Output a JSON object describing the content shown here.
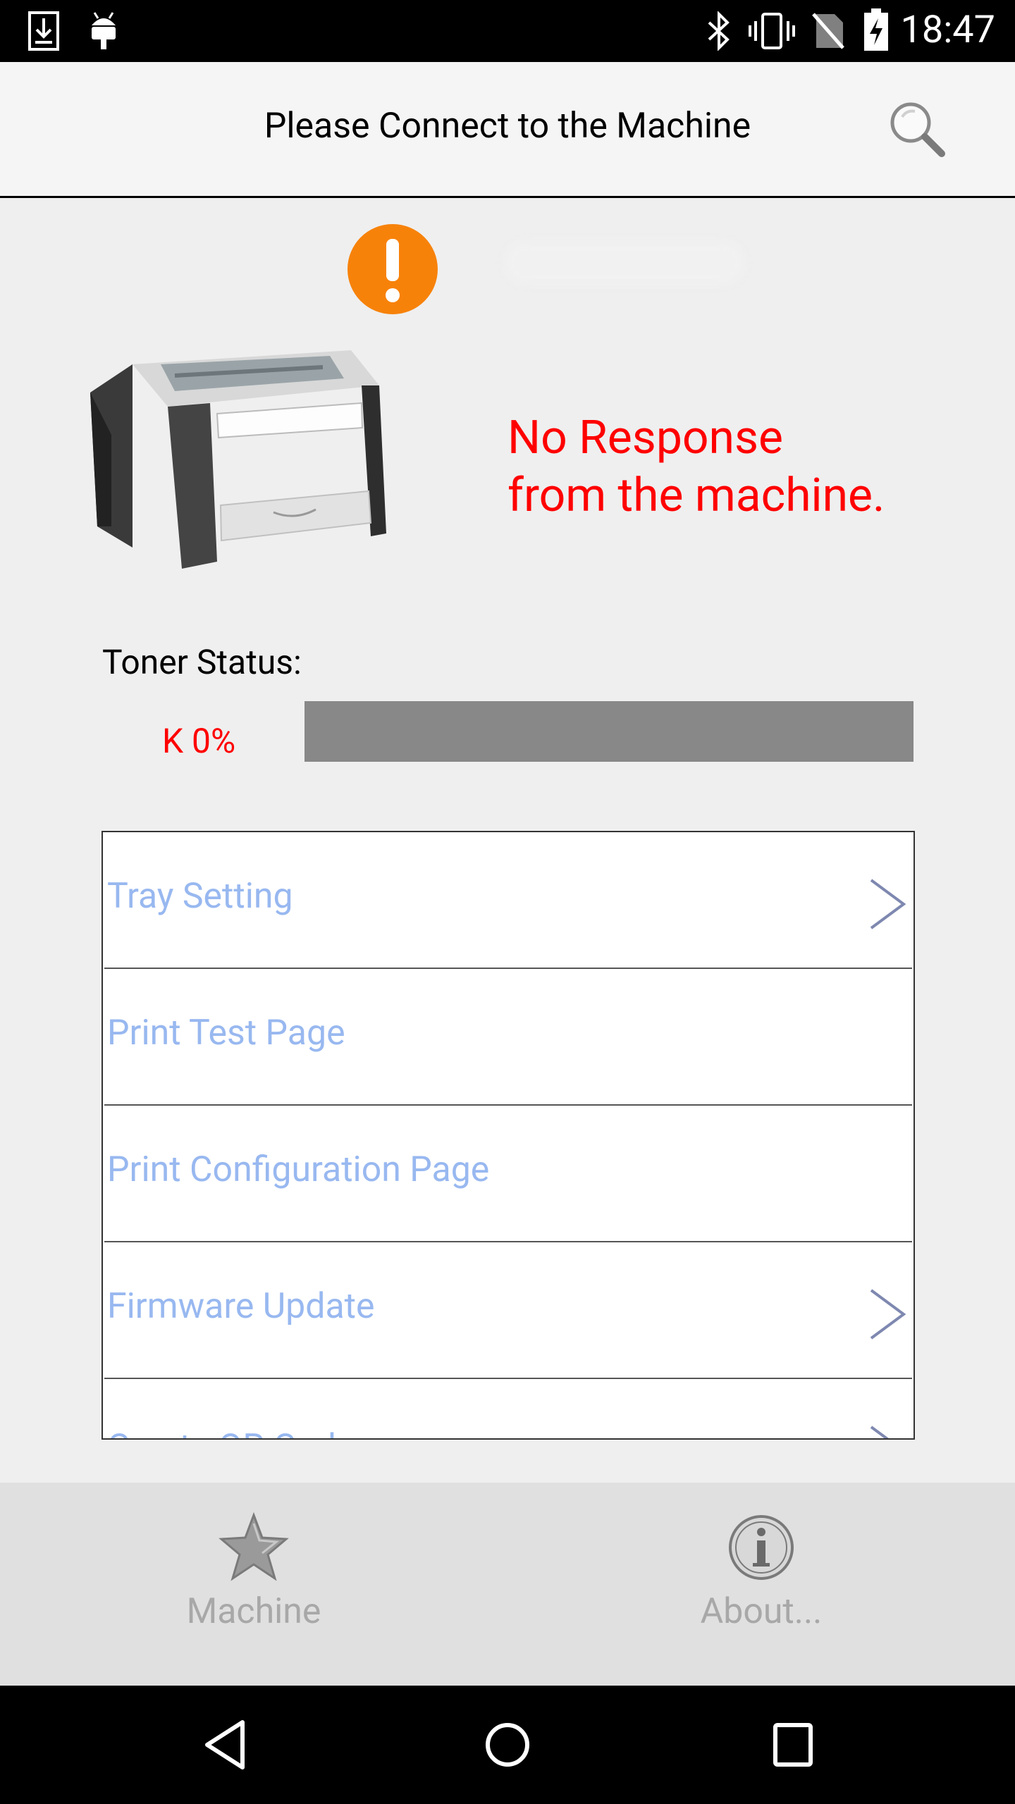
{
  "status_bar": {
    "time": "18:47",
    "icons": [
      "download-icon",
      "android-debug-icon",
      "bluetooth-icon",
      "vibrate-icon",
      "no-sim-icon",
      "battery-charging-icon"
    ]
  },
  "header": {
    "title": "Please Connect to the Machine",
    "search_icon": "search-icon"
  },
  "machine": {
    "status_icon": "warning-icon",
    "status_message": "No Response\nfrom the machine.",
    "toner": {
      "label": "Toner Status:",
      "level_text": "K 0%",
      "level_fraction": 0.0
    }
  },
  "menu": {
    "items": [
      {
        "label": "Tray Setting",
        "has_chevron": true
      },
      {
        "label": "Print Test Page",
        "has_chevron": false
      },
      {
        "label": "Print Configuration Page",
        "has_chevron": false
      },
      {
        "label": "Firmware Update",
        "has_chevron": true
      },
      {
        "label": "Create QR Code",
        "has_chevron": true
      }
    ]
  },
  "bottom_nav": {
    "tabs": [
      {
        "label": "Machine",
        "icon": "star-icon"
      },
      {
        "label": "About...",
        "icon": "info-icon"
      }
    ]
  },
  "colors": {
    "error_red": "#ff0000",
    "menu_text": "#98b8f0",
    "warning_orange": "#f7820a",
    "toner_empty": "#888888"
  }
}
